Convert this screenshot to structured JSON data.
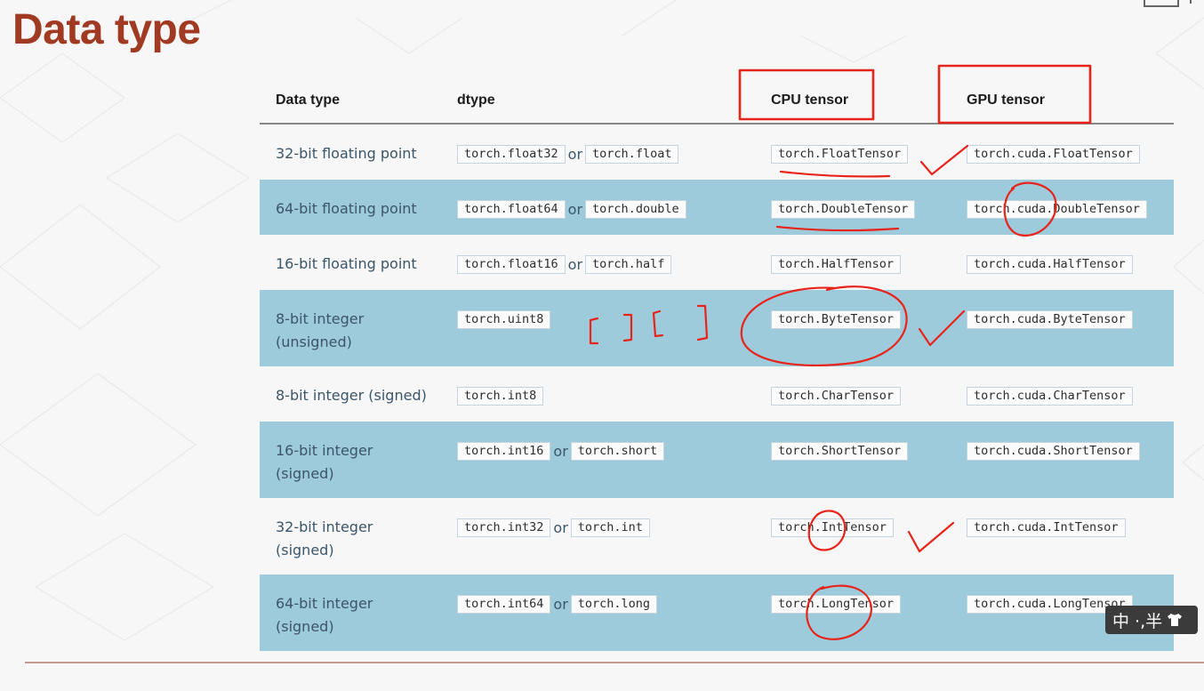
{
  "slide": {
    "title": "Data type"
  },
  "table": {
    "headers": [
      "Data type",
      "dtype",
      "CPU tensor",
      "GPU tensor"
    ],
    "or_label": "or",
    "rows": [
      {
        "type": "32-bit floating point",
        "dtypes": [
          "torch.float32",
          "torch.float"
        ],
        "cpu": "torch.FloatTensor",
        "gpu": "torch.cuda.FloatTensor"
      },
      {
        "type": "64-bit floating point",
        "dtypes": [
          "torch.float64",
          "torch.double"
        ],
        "cpu": "torch.DoubleTensor",
        "gpu": "torch.cuda.DoubleTensor"
      },
      {
        "type": "16-bit floating point",
        "dtypes": [
          "torch.float16",
          "torch.half"
        ],
        "cpu": "torch.HalfTensor",
        "gpu": "torch.cuda.HalfTensor"
      },
      {
        "type": "8-bit integer (unsigned)",
        "dtypes": [
          "torch.uint8"
        ],
        "cpu": "torch.ByteTensor",
        "gpu": "torch.cuda.ByteTensor"
      },
      {
        "type": "8-bit integer (signed)",
        "dtypes": [
          "torch.int8"
        ],
        "cpu": "torch.CharTensor",
        "gpu": "torch.cuda.CharTensor"
      },
      {
        "type": "16-bit integer (signed)",
        "dtypes": [
          "torch.int16",
          "torch.short"
        ],
        "cpu": "torch.ShortTensor",
        "gpu": "torch.cuda.ShortTensor"
      },
      {
        "type": "32-bit integer (signed)",
        "dtypes": [
          "torch.int32",
          "torch.int"
        ],
        "cpu": "torch.IntTensor",
        "gpu": "torch.cuda.IntTensor"
      },
      {
        "type": "64-bit integer (signed)",
        "dtypes": [
          "torch.int64",
          "torch.long"
        ],
        "cpu": "torch.LongTensor",
        "gpu": "torch.cuda.LongTensor"
      }
    ]
  },
  "ime": {
    "label": "中 ·,半"
  },
  "colors": {
    "title": "#a13a22",
    "row_shade": "#9ecbdb",
    "annotation": "#e8231a"
  }
}
